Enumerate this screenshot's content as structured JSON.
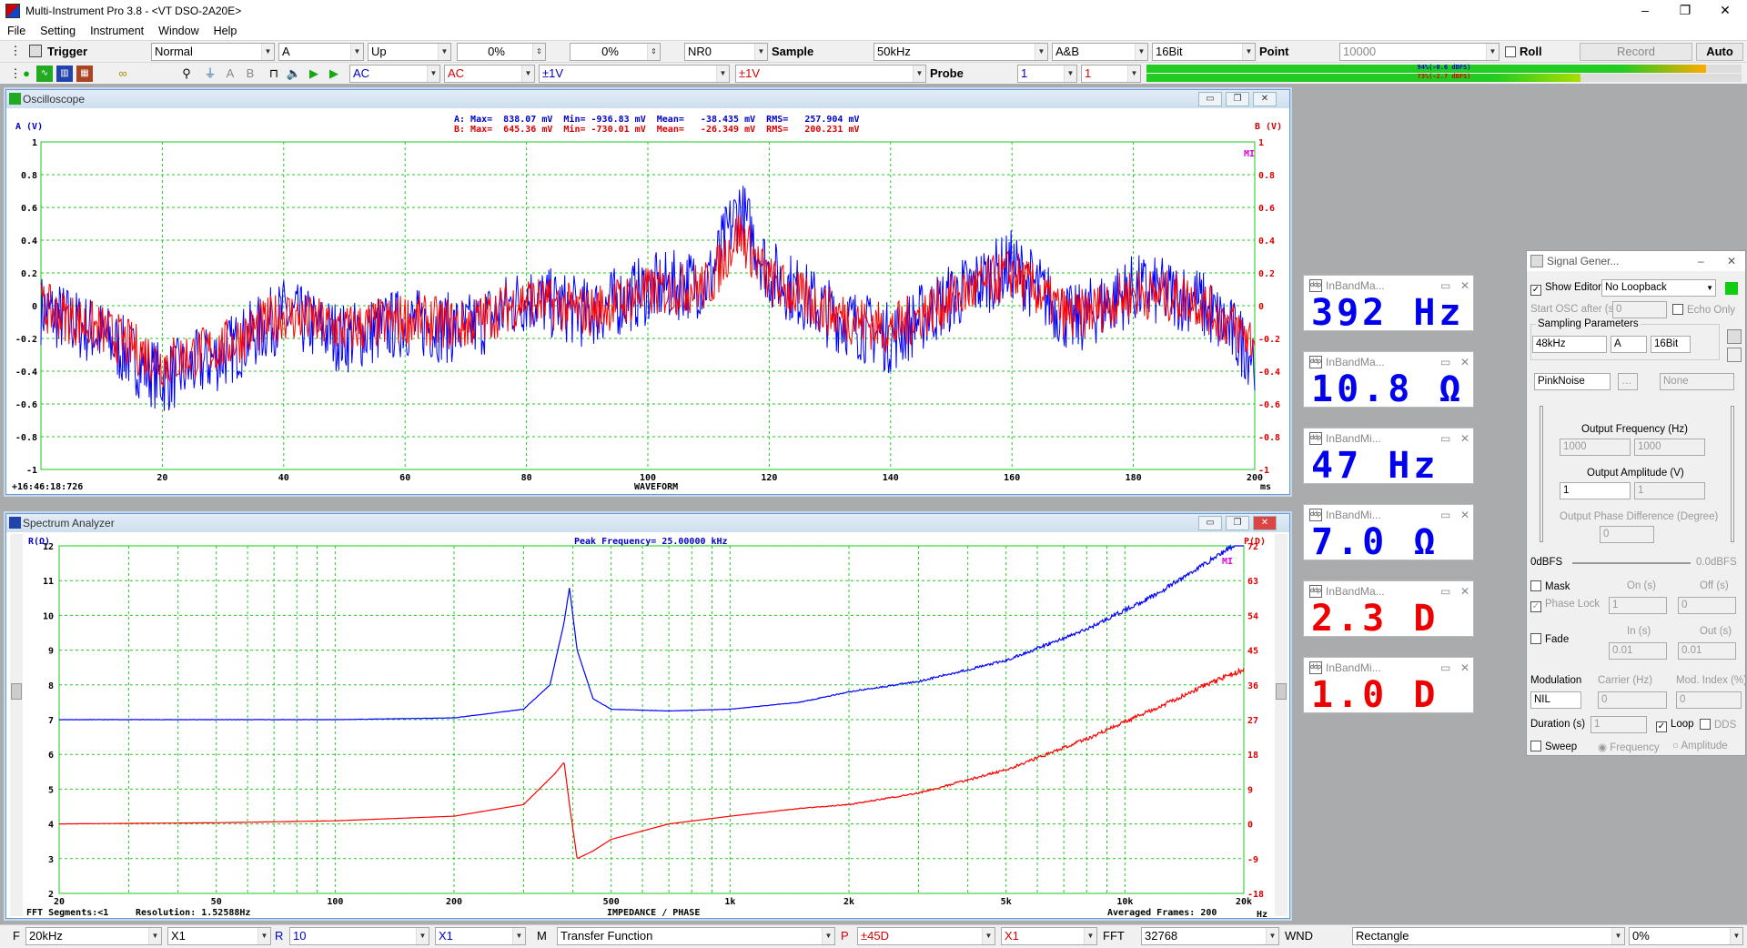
{
  "app": {
    "title": "Multi-Instrument Pro 3.8   - <VT DSO-2A20E>",
    "menu": [
      "File",
      "Setting",
      "Instrument",
      "Window",
      "Help"
    ]
  },
  "toolbar1": {
    "trigger_label": "Trigger",
    "mode": "Normal",
    "channel": "A",
    "edge": "Up",
    "pct1": "0%",
    "pct2": "0%",
    "nr": "NR0",
    "sample_label": "Sample",
    "sample_rate": "50kHz",
    "channels": "A&B",
    "bits": "16Bit",
    "point_label": "Point",
    "points": "10000",
    "roll_label": "Roll",
    "record_label": "Record",
    "auto_label": "Auto"
  },
  "toolbar2": {
    "coupling_a": "AC",
    "coupling_b": "AC",
    "range_a": "±1V",
    "range_b": "±1V",
    "probe_label": "Probe",
    "probe_a": "1",
    "probe_b": "1",
    "level_a": "94%(-0.6 dBFS)",
    "level_b": "73%(-2.7 dBFS)",
    "level_a_fill": 0.94,
    "level_b_fill": 0.73
  },
  "osc": {
    "title": "Oscilloscope",
    "a_axis": "A (V)",
    "b_axis": "B (V)",
    "stats_a": "A: Max=  838.07 mV  Min= -936.83 mV  Mean=   -38.435 mV  RMS=   257.904 mV",
    "stats_b": "B: Max=  645.36 mV  Min= -730.01 mV  Mean=   -26.349 mV  RMS=   200.231 mV",
    "timestamp": "+16:46:18:726",
    "xlabel": "WAVEFORM",
    "unit": "ms",
    "logo": "MI",
    "y_ticks": [
      "1",
      "0.8",
      "0.6",
      "0.4",
      "0.2",
      "0",
      "-0.2",
      "-0.4",
      "-0.6",
      "-0.8",
      "-1"
    ],
    "x_ticks": [
      "20",
      "40",
      "60",
      "80",
      "100",
      "120",
      "140",
      "160",
      "180",
      "200"
    ]
  },
  "spec": {
    "title": "Spectrum Analyzer",
    "r_axis": "R(Ω)",
    "p_axis": "P(D)",
    "peak": "Peak Frequency= 25.00000 kHz",
    "fft_seg": "FFT Segments:<1",
    "resolution": "Resolution: 1.52588Hz",
    "xlabel": "IMPEDANCE / PHASE",
    "averaged": "Averaged Frames: 200",
    "unit": "Hz",
    "logo": "MI",
    "r_ticks": [
      "12",
      "11",
      "10",
      "9",
      "8",
      "7",
      "6",
      "5",
      "4",
      "3",
      "2"
    ],
    "p_ticks": [
      "72",
      "63",
      "54",
      "45",
      "36",
      "27",
      "18",
      "9",
      "0",
      "-9",
      "-18"
    ],
    "x_ticks": [
      "20",
      "50",
      "100",
      "200",
      "500",
      "1k",
      "2k",
      "5k",
      "10k",
      "20k"
    ]
  },
  "meters": [
    {
      "title": "InBandMa...",
      "value": "392  Hz",
      "color": "#0000ee"
    },
    {
      "title": "InBandMa...",
      "value": "10.8  Ω",
      "color": "#0000ee"
    },
    {
      "title": "InBandMi...",
      "value": "47  Hz",
      "color": "#0000ee"
    },
    {
      "title": "InBandMi...",
      "value": "7.0  Ω",
      "color": "#0000ee"
    },
    {
      "title": "InBandMa...",
      "value": "2.3  D",
      "color": "#ee0000"
    },
    {
      "title": "InBandMi...",
      "value": "1.0  D",
      "color": "#ee0000"
    }
  ],
  "siggen": {
    "title": "Signal Gener...",
    "show_editor": "Show Editor",
    "loopback": "No Loopback",
    "start_osc": "Start OSC after (s)",
    "start_val": "0",
    "echo_only": "Echo Only",
    "sampling_params": "Sampling Parameters",
    "rate": "48kHz",
    "channel": "A",
    "bits": "16Bit",
    "waveform": "PinkNoise",
    "none": "None",
    "out_freq": "Output Frequency (Hz)",
    "freq1": "1000",
    "freq2": "1000",
    "out_amp": "Output Amplitude (V)",
    "amp1": "1",
    "amp2": "1",
    "phase_diff": "Output Phase Difference (Degree)",
    "phase": "0",
    "dbfs_left": "0dBFS",
    "dbfs_right": "0.0dBFS",
    "mask": "Mask",
    "on_s": "On (s)",
    "off_s": "Off (s)",
    "phase_lock": "Phase Lock",
    "on_val": "1",
    "off_val": "0",
    "fade": "Fade",
    "in_s": "In (s)",
    "out_s": "Out (s)",
    "in_val": "0.01",
    "out_val": "0.01",
    "modulation": "Modulation",
    "carrier": "Carrier (Hz)",
    "mod_index": "Mod. Index (%)",
    "mod_val": "NIL",
    "carrier_val": "0",
    "mod_index_val": "0",
    "duration": "Duration (s)",
    "duration_val": "1",
    "loop": "Loop",
    "dds": "DDS",
    "sweep": "Sweep",
    "frequency": "Frequency",
    "amplitude": "Amplitude"
  },
  "bottom": {
    "f_label": "F",
    "f_val": "20kHz",
    "fx": "X1",
    "r_label": "R",
    "r_val": "10",
    "rx": "X1",
    "m_label": "M",
    "m_val": "Transfer Function",
    "p_label": "P",
    "p_val": "±45D",
    "px": "X1",
    "fft_label": "FFT",
    "fft_val": "32768",
    "wnd_label": "WND",
    "wnd_val": "Rectangle",
    "pct": "0%"
  },
  "chart_data": [
    {
      "type": "line",
      "title": "Oscilloscope",
      "xlabel": "WAVEFORM",
      "x_unit": "ms",
      "ylabel": "A (V)",
      "y2label": "B (V)",
      "xlim": [
        0,
        200
      ],
      "ylim": [
        -1,
        1
      ],
      "grid": true,
      "series": [
        {
          "name": "A",
          "color": "#0000ff",
          "x": [
            0,
            10,
            20,
            30,
            40,
            50,
            60,
            70,
            80,
            90,
            100,
            110,
            115,
            120,
            130,
            140,
            150,
            160,
            170,
            180,
            190,
            200
          ],
          "y": [
            -0.02,
            -0.18,
            -0.45,
            -0.3,
            -0.05,
            -0.2,
            -0.1,
            -0.15,
            0.05,
            -0.05,
            0.1,
            0.15,
            0.6,
            0.2,
            -0.05,
            -0.2,
            0.05,
            0.25,
            -0.1,
            0.1,
            0.05,
            -0.3
          ]
        },
        {
          "name": "B",
          "color": "#ff0000",
          "x": [
            0,
            10,
            20,
            30,
            40,
            50,
            60,
            70,
            80,
            90,
            100,
            110,
            115,
            120,
            130,
            140,
            150,
            160,
            170,
            180,
            190,
            200
          ],
          "y": [
            -0.01,
            -0.15,
            -0.35,
            -0.25,
            -0.05,
            -0.15,
            -0.08,
            -0.12,
            0.04,
            -0.04,
            0.08,
            0.12,
            0.45,
            0.15,
            -0.04,
            -0.15,
            0.04,
            0.2,
            -0.08,
            0.08,
            0.04,
            -0.22
          ]
        }
      ]
    },
    {
      "type": "line",
      "title": "Spectrum Analyzer",
      "xlabel": "IMPEDANCE / PHASE",
      "x_unit": "Hz",
      "x_scale": "log",
      "xlim": [
        20,
        20000
      ],
      "ylabel": "R(Ω)",
      "ylim": [
        2,
        12
      ],
      "y2label": "P(D)",
      "y2lim": [
        -18,
        72
      ],
      "grid": true,
      "series": [
        {
          "name": "R",
          "color": "#0000ff",
          "x": [
            20,
            50,
            100,
            200,
            300,
            350,
            380,
            392,
            410,
            450,
            500,
            700,
            1000,
            1500,
            2000,
            3000,
            5000,
            8000,
            12000,
            16000,
            20000
          ],
          "y": [
            7.0,
            7.0,
            7.0,
            7.05,
            7.3,
            8.0,
            9.8,
            10.8,
            9.0,
            7.6,
            7.3,
            7.25,
            7.3,
            7.5,
            7.8,
            8.1,
            8.7,
            9.6,
            10.6,
            11.5,
            12.2
          ]
        },
        {
          "name": "P",
          "color": "#ff0000",
          "x": [
            20,
            50,
            100,
            200,
            300,
            360,
            380,
            392,
            410,
            450,
            500,
            700,
            1000,
            1500,
            2000,
            3000,
            5000,
            8000,
            12000,
            16000,
            20000
          ],
          "y": [
            0,
            0.3,
            0.8,
            2,
            5,
            13,
            16,
            5,
            -9,
            -7,
            -4,
            0,
            2,
            4,
            5,
            8,
            14,
            22,
            30,
            36,
            40
          ]
        }
      ]
    }
  ]
}
